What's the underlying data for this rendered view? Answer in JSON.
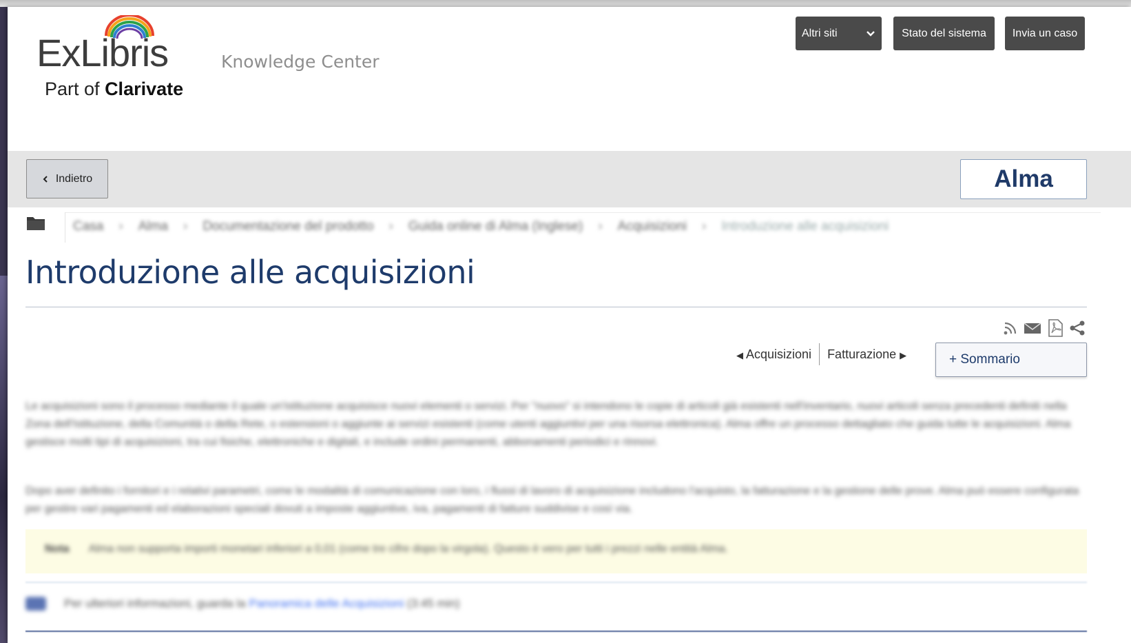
{
  "header": {
    "logo_text": "ExLibris",
    "logo_subtitle": "Knowledge Center",
    "part_of_prefix": "Part of",
    "part_of_brand": "Clarivate",
    "buttons": {
      "other_sites": "Altri siti",
      "system_status": "Stato del sistema",
      "submit_case": "Invia un caso"
    }
  },
  "nav": {
    "back_label": "Indietro",
    "product_label": "Alma"
  },
  "breadcrumb": {
    "items": [
      "Casa",
      "Alma",
      "Documentazione del prodotto",
      "Guida online di Alma (Inglese)",
      "Acquisizioni",
      "Introduzione alle acquisizioni"
    ],
    "separator": "›"
  },
  "page": {
    "title": "Introduzione alle acquisizioni",
    "prev_label": "Acquisizioni",
    "next_label": "Fatturazione",
    "toc_label": "+ Sommario"
  },
  "tools": {
    "icons": [
      "rss-icon",
      "email-icon",
      "pdf-icon",
      "share-icon"
    ]
  },
  "body": {
    "paragraph1": "Le acquisizioni sono il processo mediante il quale un'istituzione acquisisce nuovi elementi o servizi. Per \"nuovo\" si intendono le copie di articoli già esistenti nell'inventario, nuovi articoli senza precedenti definiti nella Zona dell'Istituzione, della Comunità o della Rete, o estensioni o aggiunte ai servizi esistenti (come utenti aggiuntivi per una risorsa elettronica). Alma offre un processo dettagliato che guida tutte le acquisizioni. Alma gestisce molti tipi di acquisizioni, tra cui fisiche, elettroniche e digitali, e include ordini permanenti, abbonamenti periodici e rinnovi.",
    "paragraph2": "Dopo aver definito i fornitori e i relativi parametri, come le modalità di comunicazione con loro, i flussi di lavoro di acquisizione includono l'acquisto, la fatturazione e la gestione delle prove. Alma può essere configurata per gestire vari pagamenti ed elaborazioni speciali dovuti a imposte aggiuntive, iva, pagamenti di fatture suddivise e così via.",
    "note_label": "Nota",
    "note_text": "Alma non supporta importi monetari inferiori a 0,01 (come tre cifre dopo la virgola). Questo è vero per tutti i prezzi nelle entità Alma.",
    "video_prefix": "Per ulteriori informazioni, guarda la",
    "video_link": "Panoramica delle Acquisizioni",
    "video_suffix": "(3:45 min)"
  }
}
